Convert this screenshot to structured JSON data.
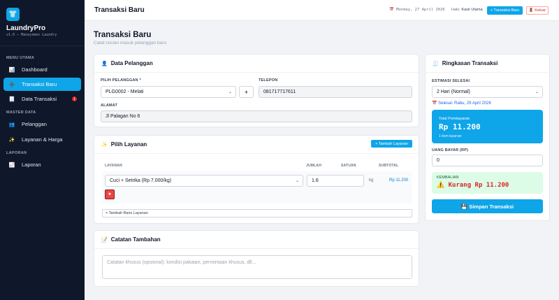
{
  "app": {
    "name": "LaundryPro",
    "version": "v1.0 — Manajemen Laundry"
  },
  "sidebar": {
    "sections": [
      "MENU UTAMA",
      "MASTER DATA",
      "LAPORAN"
    ],
    "items": [
      {
        "label": "Dashboard",
        "icon": "chart-icon",
        "glyph": "📊"
      },
      {
        "label": "Transaksi Baru",
        "icon": "plus-icon",
        "glyph": "➕"
      },
      {
        "label": "Data Transaksi",
        "icon": "list-icon",
        "glyph": "📃",
        "badge": "1"
      },
      {
        "label": "Pelanggan",
        "icon": "users-icon",
        "glyph": "👥"
      },
      {
        "label": "Layanan & Harga",
        "icon": "sparkle-icon",
        "glyph": "✨"
      },
      {
        "label": "Laporan",
        "icon": "report-icon",
        "glyph": "📈"
      }
    ]
  },
  "topbar": {
    "title": "Transaksi Baru",
    "date": "📅 Monday, 27 April 2026",
    "hello": "Halo:",
    "user": "Kasir Utama",
    "new_btn": "+ Transaksi Baru",
    "logout_btn": "🚪 Keluar"
  },
  "page": {
    "title": "Transaksi Baru",
    "subtitle": "Catat cucian masuk pelanggan baru"
  },
  "customer": {
    "heading": "Data Pelanggan",
    "pick_label": "PILIH PELANGGAN *",
    "pick_value": "PLG0002 - Melati",
    "add_btn": "+",
    "phone_label": "TELEPON",
    "phone_value": "081717717611",
    "address_label": "ALAMAT",
    "address_value": "Jl Palagan No 6"
  },
  "services": {
    "heading": "Pilih Layanan",
    "add_btn": "+ Tambah Layanan",
    "cols": [
      "LAYANAN",
      "JUMLAH",
      "SATUAN",
      "SUBTOTAL"
    ],
    "row": {
      "service": "Cuci + Setrika (Rp 7.000/kg)",
      "qty": "1.6",
      "unit": "kg",
      "subtotal": "Rp 11.200",
      "delete": "✖"
    },
    "add_row": "+ Tambah Baris Layanan"
  },
  "notes": {
    "heading": "Catatan Tambahan",
    "placeholder": "Catatan khusus (opsional): kondisi pakaian, permintaan khusus, dll..."
  },
  "summary": {
    "heading": "Ringkasan Transaksi",
    "est_label": "ESTIMASI SELESAI",
    "est_value": "2 Hari (Normal)",
    "done_text": "📅 Selesai: Rabu, 29 April 2026",
    "total_label": "Total Pembayaran",
    "total_value": "Rp 11.200",
    "item_count": "1 item layanan",
    "pay_label": "UANG BAYAR (RP)",
    "pay_value": "0",
    "change_label": "KEMBALIAN",
    "change_value": "⚠️ Kurang Rp 11.200",
    "save_btn": "💾 Simpan Transaksi"
  },
  "colors": {
    "accent": "#0ea5e9",
    "sidebar": "#0f172a",
    "danger": "#dc2626",
    "success_bg": "#dcfce7"
  }
}
